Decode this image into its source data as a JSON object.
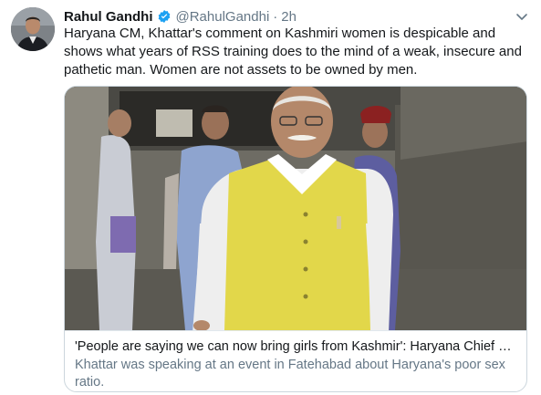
{
  "tweet": {
    "author": {
      "display_name": "Rahul Gandhi",
      "handle": "@RahulGandhi",
      "verified": true,
      "avatar_icon": "profile-photo"
    },
    "separator": "·",
    "timestamp": "2h",
    "menu_icon": "chevron-down-icon",
    "text": "Haryana CM, Khattar's comment on Kashmiri women is despicable and shows what years of RSS training does to the mind of a weak, insecure and pathetic man. Women are not assets to be owned by men.",
    "card": {
      "title": "'People are saying we can now bring girls from Kashmir': Haryana Chief Minister Khattar",
      "description": "Khattar was speaking at an event in Fatehabad about Haryana's poor sex ratio."
    }
  },
  "colors": {
    "text_primary": "#14171a",
    "text_secondary": "#657786",
    "verified_blue": "#1da1f2",
    "card_border": "#ccd6dd"
  }
}
